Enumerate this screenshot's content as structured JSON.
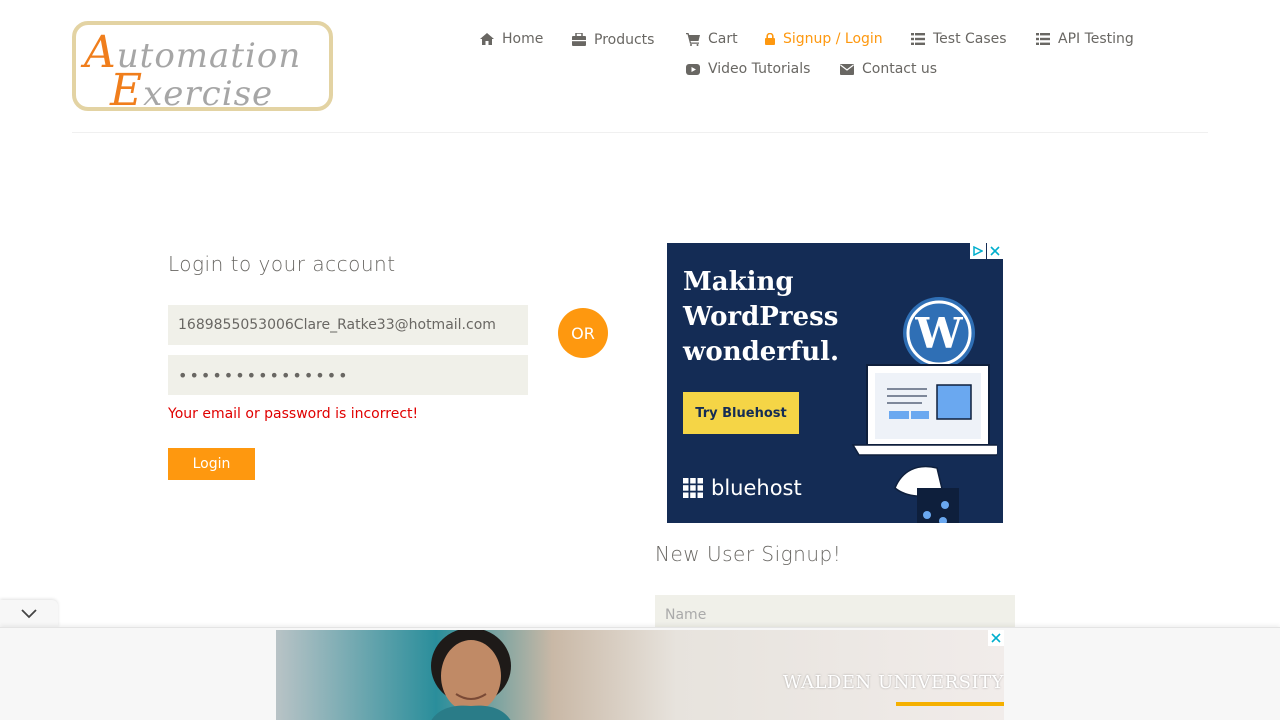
{
  "logo": {
    "line1_cap": "A",
    "line1_rest": "utomation",
    "line2_cap": "E",
    "line2_rest": "xercise"
  },
  "nav": {
    "home": "Home",
    "products": "Products",
    "cart": "Cart",
    "signup_login": "Signup / Login",
    "test_cases": "Test Cases",
    "api_testing": "API Testing",
    "video_tutorials": "Video Tutorials",
    "contact_us": "Contact us"
  },
  "login": {
    "title": "Login to your account",
    "email_value": "1689855053006Clare_Ratke33@hotmail.com",
    "password_value": "•••••••••••••••",
    "error": "Your email or password is incorrect!",
    "button": "Login"
  },
  "or_label": "OR",
  "ad": {
    "headline": "Making WordPress wonderful.",
    "cta": "Try Bluehost",
    "brand": "bluehost"
  },
  "signup": {
    "title": "New User Signup!",
    "name_placeholder": "Name"
  },
  "banner": {
    "brand": "WALDEN UNIVERSITY"
  },
  "colors": {
    "accent": "#fe980f",
    "error": "#e00000",
    "field_bg": "#f0f0e9",
    "ad_bg": "#142c55"
  }
}
